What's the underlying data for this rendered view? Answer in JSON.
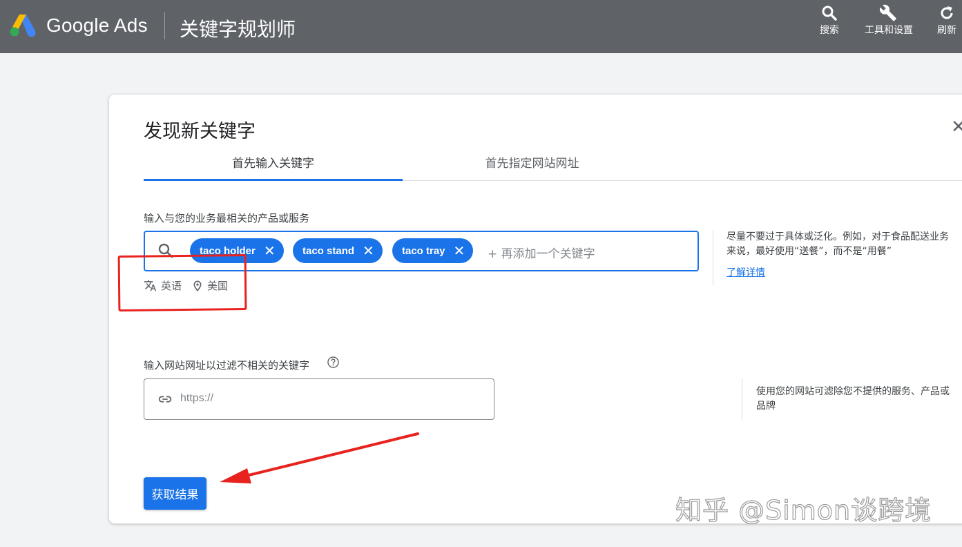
{
  "header": {
    "brand": "Google Ads",
    "page_title": "关键字规划师",
    "tools": [
      {
        "label": "搜索",
        "icon": "search-icon"
      },
      {
        "label": "工具和设置",
        "icon": "wrench-icon"
      },
      {
        "label": "刷新",
        "icon": "refresh-icon"
      }
    ]
  },
  "dialog": {
    "title": "发现新关键字",
    "close_label": "✕",
    "tabs": [
      {
        "label": "首先输入关键字",
        "active": true
      },
      {
        "label": "首先指定网站网址",
        "active": false
      }
    ],
    "keyword_section": {
      "label": "输入与您的业务最相关的产品或服务",
      "chips": [
        "taco holder",
        "taco stand",
        "taco tray"
      ],
      "add_placeholder": "+ 再添加一个关键字",
      "language": "英语",
      "location": "美国",
      "hint": "尽量不要过于具体或泛化。例如，对于食品配送业务来说，最好使用“送餐”，而不是“用餐”",
      "learn_more": "了解详情"
    },
    "url_section": {
      "label": "输入网站网址以过滤不相关的关键字",
      "placeholder": "https://",
      "hint": "使用您的网站可滤除您不提供的服务、产品或品牌"
    },
    "submit_label": "获取结果"
  },
  "watermark": "知乎 @Simon谈跨境",
  "colors": {
    "topbar": "#5f6368",
    "accent": "#1a73e8",
    "annotation": "#e8231f"
  }
}
